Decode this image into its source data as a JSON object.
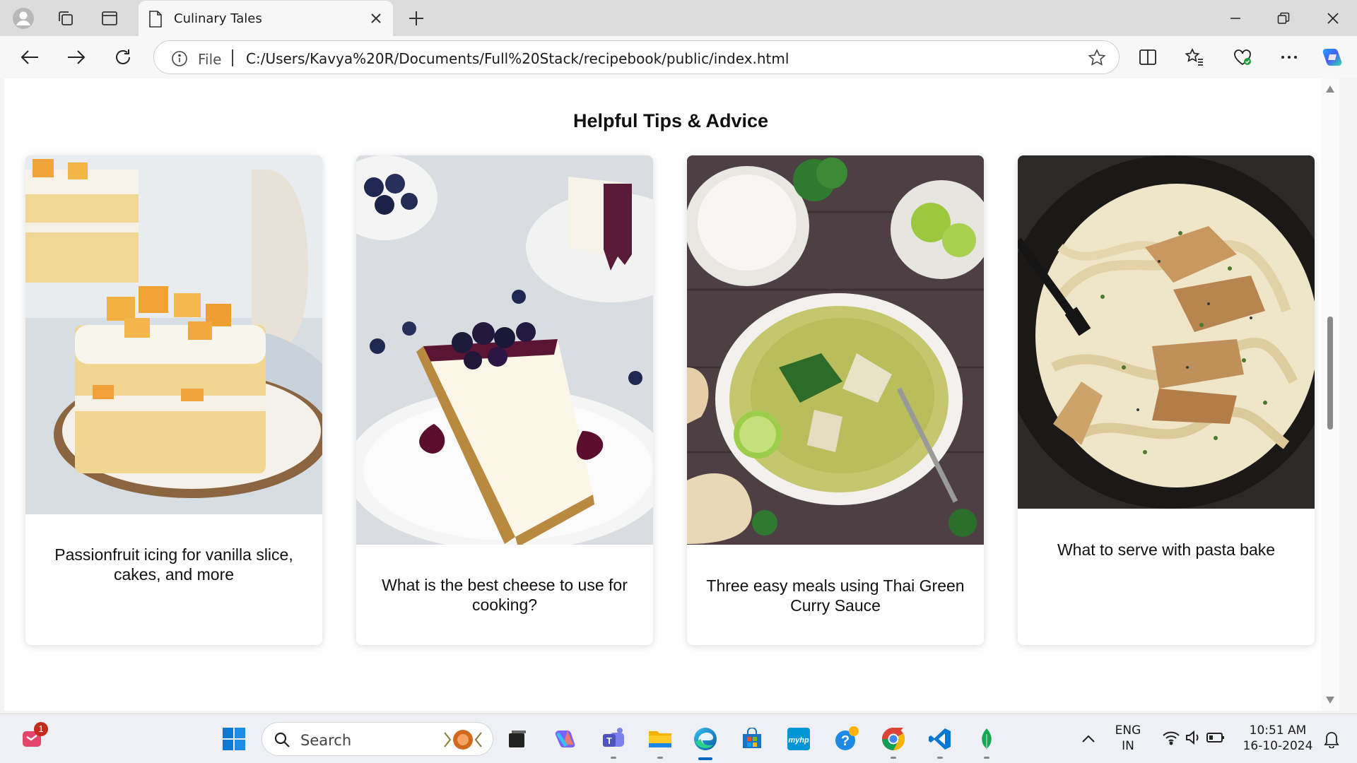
{
  "browser": {
    "tab": {
      "title": "Culinary Tales"
    },
    "address": {
      "scheme_label": "File",
      "url": "C:/Users/Kavya%20R/Documents/Full%20Stack/recipebook/public/index.html"
    }
  },
  "page": {
    "section_title": "Helpful Tips & Advice",
    "cards": [
      {
        "title": "Passionfruit icing for vanilla slice, cakes, and more",
        "image": "mango-cream-cake"
      },
      {
        "title": "What is the best cheese to use for cooking?",
        "image": "blueberry-cheesecake"
      },
      {
        "title": "Three easy meals using Thai Green Curry Sauce",
        "image": "thai-green-curry"
      },
      {
        "title": "What to serve with pasta bake",
        "image": "chicken-alfredo-pasta"
      }
    ]
  },
  "taskbar": {
    "notification_count": "1",
    "search_placeholder": "Search",
    "language": {
      "line1": "ENG",
      "line2": "IN"
    },
    "time": "10:51 AM",
    "date": "16-10-2024"
  },
  "colors": {
    "accent": "#0067c0",
    "page_background": "#ffffff"
  }
}
